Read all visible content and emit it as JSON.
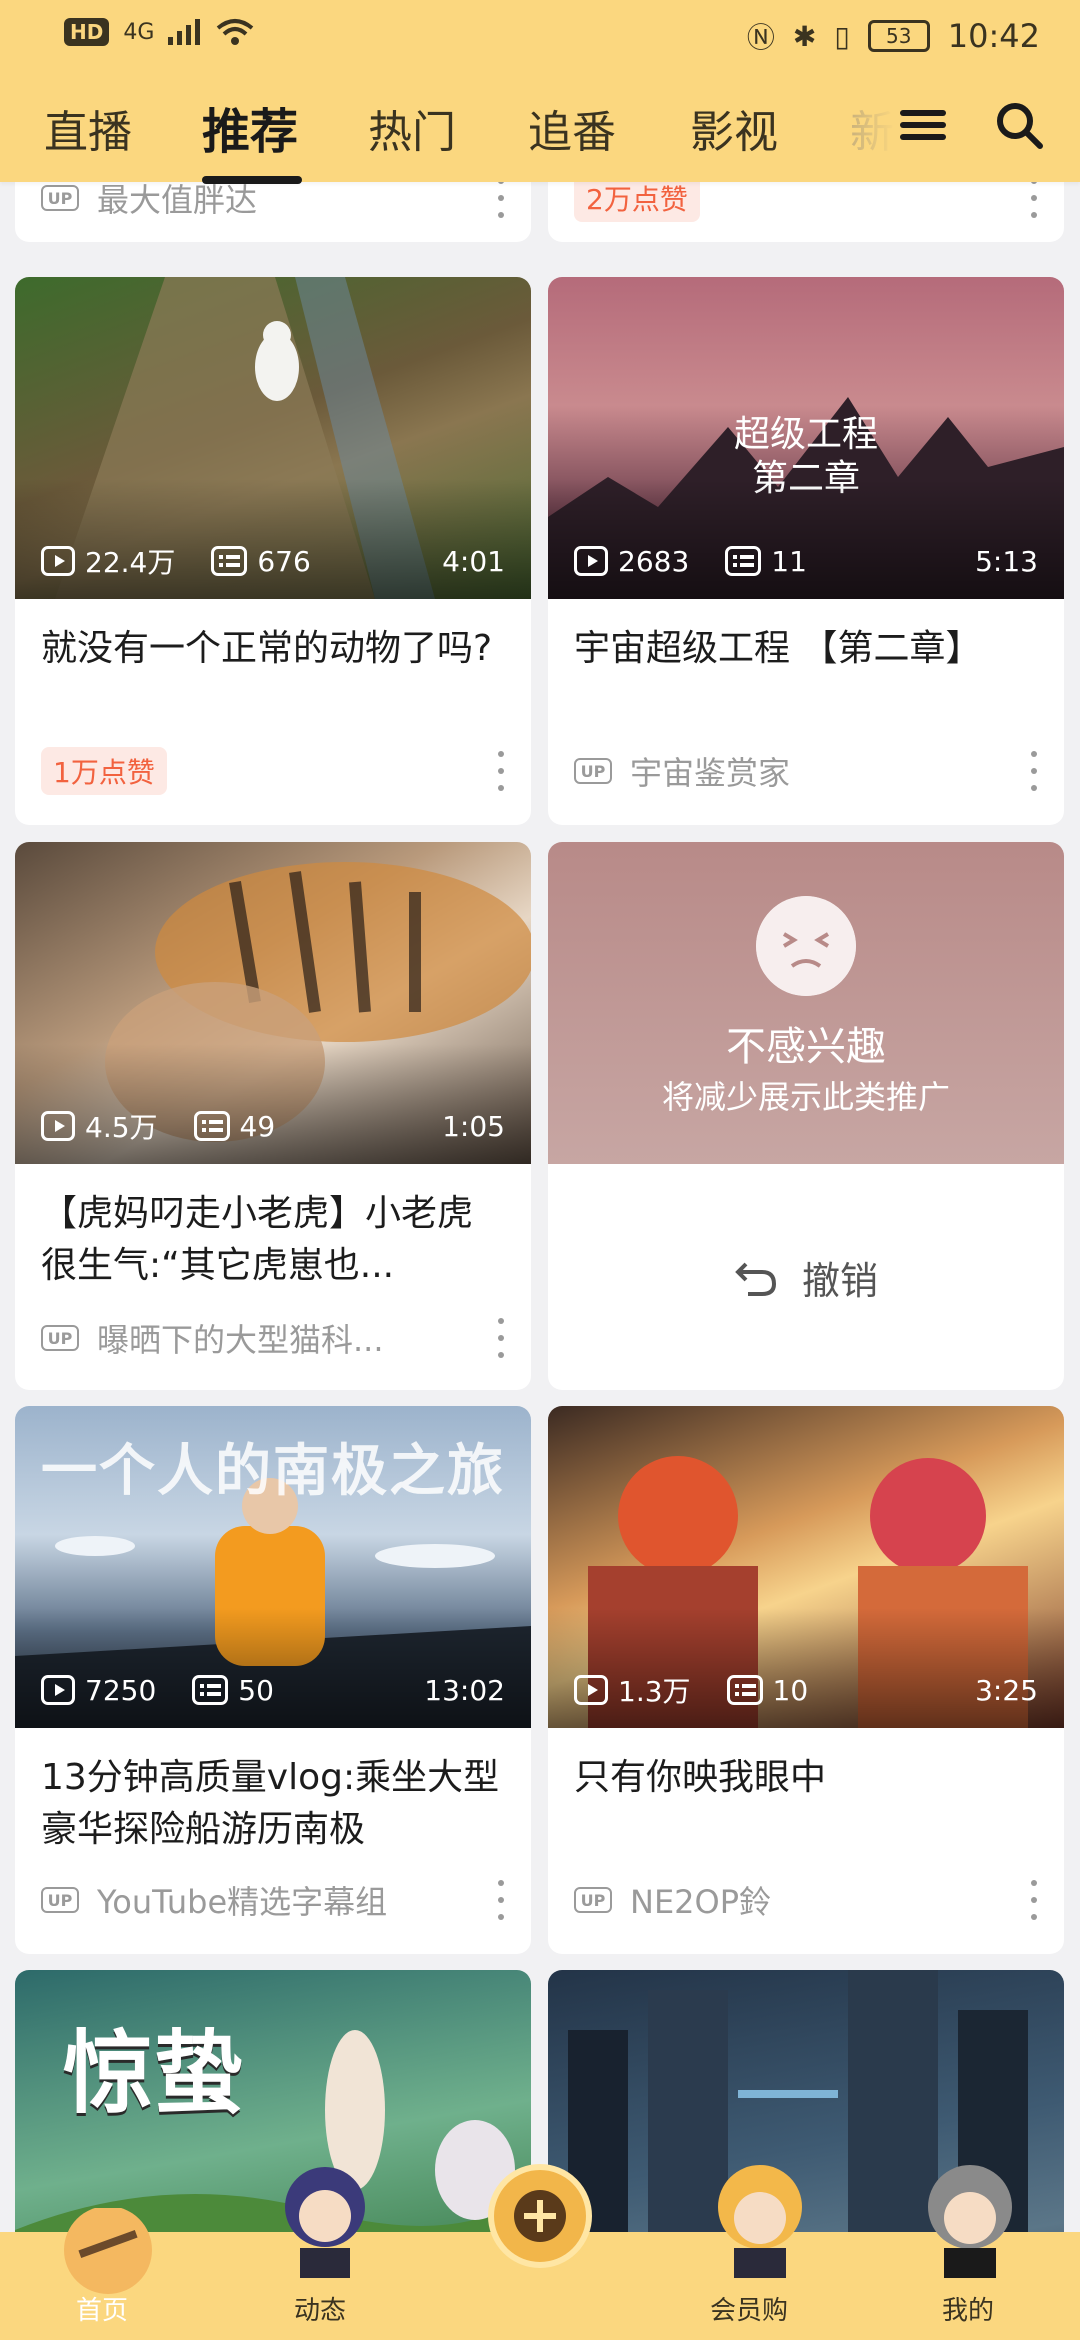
{
  "status_bar": {
    "hd": "HD",
    "network": "4G",
    "battery": "53",
    "time": "10:42"
  },
  "tabs": [
    "直播",
    "推荐",
    "热门",
    "追番",
    "影视",
    "新"
  ],
  "active_tab": "推荐",
  "partial_top": {
    "left_up": "最大值胖达",
    "right_like": "2万点赞"
  },
  "cards": [
    {
      "views": "22.4万",
      "danmaku": "676",
      "duration": "4:01",
      "title": "就没有一个正常的动物了吗?",
      "like_badge": "1万点赞"
    },
    {
      "views": "2683",
      "danmaku": "11",
      "duration": "5:13",
      "overlay": [
        "超级工程",
        "第二章"
      ],
      "title": "宇宙超级工程 【第二章】",
      "up": "宇宙鉴赏家"
    },
    {
      "views": "4.5万",
      "danmaku": "49",
      "duration": "1:05",
      "title": "【虎妈叼走小老虎】小老虎很生气:“其它虎崽也...",
      "up": "曝晒下的大型猫科..."
    },
    {
      "views": "7250",
      "danmaku": "50",
      "duration": "13:02",
      "overlay": [
        "一个人的南极之旅"
      ],
      "title": "13分钟高质量vlog:乘坐大型豪华探险船游历南极",
      "up": "YouTube精选字幕组"
    },
    {
      "views": "1.3万",
      "danmaku": "10",
      "duration": "3:25",
      "title": "只有你映我眼中",
      "up": "NE2OP鈴"
    },
    {
      "overlay": [
        "惊蛰"
      ]
    }
  ],
  "not_interested": {
    "title": "不感兴趣",
    "subtitle": "将减少展示此类推广",
    "undo": "撤销"
  },
  "up_label": "UP",
  "bottom_nav": {
    "home": "首页",
    "dynamic": "动态",
    "vip": "会员购",
    "mine": "我的"
  }
}
